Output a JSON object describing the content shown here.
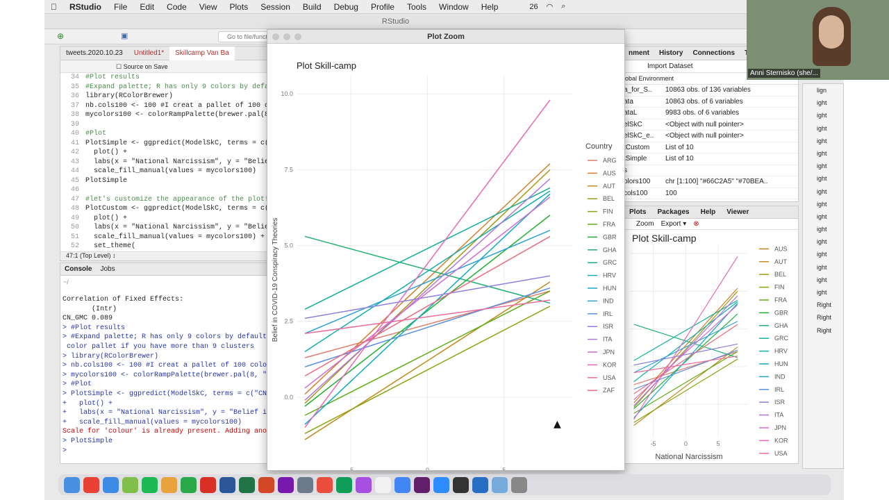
{
  "menubar": {
    "apple": "",
    "app": "RStudio",
    "items": [
      "File",
      "Edit",
      "Code",
      "View",
      "Plots",
      "Session",
      "Build",
      "Debug",
      "Profile",
      "Tools",
      "Window",
      "Help"
    ],
    "status_count": "26"
  },
  "window_title": "RStudio",
  "toolbar": {
    "goto_placeholder": "Go to file/function"
  },
  "editor": {
    "tabs": [
      "tweets.2020.10.23",
      "Untitled1*",
      "Skillcamp Van Ba"
    ],
    "source_on_save": "Source on Save",
    "lines": [
      {
        "n": "34",
        "t": "#Plot results",
        "c": true
      },
      {
        "n": "35",
        "t": "#Expand palette; R has only 9 colors by defa",
        "c": true
      },
      {
        "n": "36",
        "t": "library(RColorBrewer)",
        "c": false
      },
      {
        "n": "37",
        "t": "nb.cols100 <- 100 #I creat a pallet of 100 c",
        "c": false
      },
      {
        "n": "38",
        "t": "mycolors100 <- colorRampPalette(brewer.pal(8",
        "c": false
      },
      {
        "n": "39",
        "t": "",
        "c": false
      },
      {
        "n": "40",
        "t": "#Plot",
        "c": true
      },
      {
        "n": "41",
        "t": "PlotSimple <- ggpredict(ModelSkC, terms = c(",
        "c": false
      },
      {
        "n": "42",
        "t": "  plot() +",
        "c": false
      },
      {
        "n": "43",
        "t": "  labs(x = \"National Narcissism\", y = \"Belie",
        "c": false
      },
      {
        "n": "44",
        "t": "  scale_fill_manual(values = mycolors100)",
        "c": false
      },
      {
        "n": "45",
        "t": "PlotSimple",
        "c": false
      },
      {
        "n": "46",
        "t": "",
        "c": false
      },
      {
        "n": "47",
        "t": "#let's customize the appearance of the plot!",
        "c": true
      },
      {
        "n": "48",
        "t": "PlotCustom <- ggpredict(ModelSkC, terms = c(",
        "c": false
      },
      {
        "n": "49",
        "t": "  plot() +",
        "c": false
      },
      {
        "n": "50",
        "t": "  labs(x = \"National Narcissism\", y = \"Belie",
        "c": false
      },
      {
        "n": "51",
        "t": "  scale_fill_manual(values = mycolors100) +",
        "c": false
      },
      {
        "n": "52",
        "t": "  set_theme(",
        "c": false
      }
    ],
    "status": "47:1   (Top Level) ↕"
  },
  "console": {
    "tabs": [
      "Console",
      "Jobs"
    ],
    "path": "~/",
    "lines": [
      {
        "t": "Correlation of Fixed Effects:",
        "k": "o"
      },
      {
        "t": "       (Intr)",
        "k": "o"
      },
      {
        "t": "CN_GMC 0.089",
        "k": "o"
      },
      {
        "t": "> #Plot results",
        "k": "i"
      },
      {
        "t": "> #Expand palette; R has only 9 colors by default a",
        "k": "i"
      },
      {
        "t": " color pallet if you have more than 9 clusters",
        "k": "i"
      },
      {
        "t": "> library(RColorBrewer)",
        "k": "i"
      },
      {
        "t": "> nb.cols100 <- 100 #I creat a pallet of 100 colors",
        "k": "i"
      },
      {
        "t": "> mycolors100 <- colorRampPalette(brewer.pal(8, \"Se",
        "k": "i"
      },
      {
        "t": "> #Plot",
        "k": "i"
      },
      {
        "t": "> PlotSimple <- ggpredict(ModelSkC, terms = c(\"CN_G",
        "k": "i"
      },
      {
        "t": "+   plot() +",
        "k": "i"
      },
      {
        "t": "+   labs(x = \"National Narcissism\", y = \"Belief in",
        "k": "i"
      },
      {
        "t": "+   scale_fill_manual(values = mycolors100)",
        "k": "i"
      },
      {
        "t": "Scale for 'colour' is already present. Adding anoth",
        "k": "e"
      },
      {
        "t": "> PlotSimple",
        "k": "i"
      },
      {
        "t": "> ",
        "k": "i"
      }
    ]
  },
  "env": {
    "tabs": [
      "nment",
      "History",
      "Connections",
      "T"
    ],
    "import": "Import Dataset",
    "scope": "obal Environment",
    "rows": [
      {
        "n": "a_for_S..",
        "v": "10863 obs. of 136 variables"
      },
      {
        "n": "ata",
        "v": "10863 obs. of 6 variables"
      },
      {
        "n": "ataL",
        "v": "9983 obs. of 6 variables"
      },
      {
        "n": "elSkC",
        "v": "<Object with null pointer>"
      },
      {
        "n": "elSkC_e..",
        "v": "<Object with null pointer>"
      },
      {
        "n": "tCustom",
        "v": "List of 10"
      },
      {
        "n": "tSimple",
        "v": "List of 10"
      },
      {
        "n": "s",
        "v": ""
      },
      {
        "n": "olors100",
        "v": "chr [1:100] \"#66C2A5\" \"#70BEA.."
      },
      {
        "n": "cols100",
        "v": "100"
      }
    ]
  },
  "plots_pane": {
    "tabs": [
      "Plots",
      "Packages",
      "Help",
      "Viewer"
    ],
    "zoom": "Zoom",
    "export": "Export ▾",
    "title": "Plot Skill-camp",
    "xlabel": "National Narcissism"
  },
  "background_window": {
    "items": [
      "lign",
      "ight",
      "ight",
      "ight",
      "ight",
      "ight",
      "ight",
      "ight",
      "ight",
      "ight",
      "ight",
      "ight",
      "ight",
      "ight",
      "ight",
      "ight",
      "ight",
      "Right",
      "Right",
      "Right"
    ]
  },
  "zoom_window": {
    "title": "Plot Zoom"
  },
  "video": {
    "name": "Anni Sternisko (she/..."
  },
  "chart_data": {
    "type": "line",
    "title": "Plot Skill-camp",
    "xlabel": "National Narcissism",
    "ylabel": "Belief in COVID-19 Conspiracy Theories",
    "xlim": [
      -8.5,
      9.5
    ],
    "ylim": [
      -2.2,
      10.6
    ],
    "xticks": [
      -5,
      0,
      5
    ],
    "yticks": [
      "0.0",
      "2.5",
      "5.0",
      "7.5",
      "10.0"
    ],
    "legend_title": "Country",
    "legend_position": "right",
    "grid": true,
    "series": [
      {
        "name": "ARG",
        "color": "#e07b6a",
        "x": [
          -8,
          8
        ],
        "y": [
          1.3,
          3.5
        ]
      },
      {
        "name": "AUS",
        "color": "#d4802a",
        "x": [
          -8,
          8
        ],
        "y": [
          0.1,
          7.7
        ]
      },
      {
        "name": "AUT",
        "color": "#c48a1e",
        "x": [
          -8,
          8
        ],
        "y": [
          -1.4,
          3.8
        ]
      },
      {
        "name": "BEL",
        "color": "#a49a10",
        "x": [
          -8,
          8
        ],
        "y": [
          -0.2,
          7.5
        ]
      },
      {
        "name": "FIN",
        "color": "#8aa30e",
        "x": [
          -8,
          8
        ],
        "y": [
          -1.2,
          3.0
        ]
      },
      {
        "name": "FRA",
        "color": "#5eae18",
        "x": [
          -8,
          8
        ],
        "y": [
          -0.6,
          3.5
        ]
      },
      {
        "name": "GBR",
        "color": "#1fb02f",
        "x": [
          -8,
          8
        ],
        "y": [
          -0.3,
          6.0
        ]
      },
      {
        "name": "GHA",
        "color": "#1fb073",
        "x": [
          -8,
          8
        ],
        "y": [
          5.3,
          3.1
        ]
      },
      {
        "name": "GRC",
        "color": "#12b09a",
        "x": [
          -8,
          8
        ],
        "y": [
          2.9,
          6.9
        ]
      },
      {
        "name": "HRV",
        "color": "#0fb0ae",
        "x": [
          -8,
          8
        ],
        "y": [
          1.5,
          6.8
        ]
      },
      {
        "name": "HUN",
        "color": "#10aac6",
        "x": [
          -8,
          8
        ],
        "y": [
          -0.9,
          6.7
        ]
      },
      {
        "name": "IND",
        "color": "#29a0d8",
        "x": [
          -8,
          8
        ],
        "y": [
          2.1,
          5.5
        ]
      },
      {
        "name": "IRL",
        "color": "#5a8ee0",
        "x": [
          -8,
          8
        ],
        "y": [
          1.0,
          3.6
        ]
      },
      {
        "name": "ISR",
        "color": "#8a7fe0",
        "x": [
          -8,
          8
        ],
        "y": [
          2.6,
          4.0
        ]
      },
      {
        "name": "ITA",
        "color": "#b275dc",
        "x": [
          -8,
          8
        ],
        "y": [
          -0.1,
          7.2
        ]
      },
      {
        "name": "JPN",
        "color": "#d26ad0",
        "x": [
          -8,
          8
        ],
        "y": [
          0.3,
          6.6
        ]
      },
      {
        "name": "KOR",
        "color": "#e867bb",
        "x": [
          -8,
          8
        ],
        "y": [
          -1.0,
          9.8
        ]
      },
      {
        "name": "USA",
        "color": "#ed6a9e",
        "x": [
          -8,
          8
        ],
        "y": [
          2.1,
          3.2
        ]
      },
      {
        "name": "ZAF",
        "color": "#eb6a80",
        "x": [
          -8,
          8
        ],
        "y": [
          0.7,
          5.3
        ]
      }
    ]
  }
}
